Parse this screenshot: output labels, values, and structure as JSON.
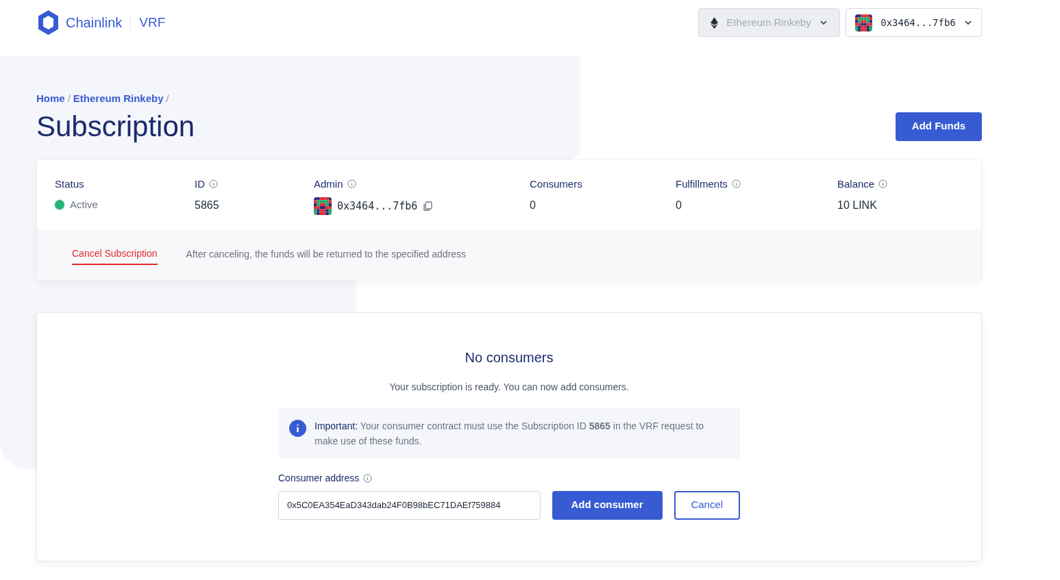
{
  "header": {
    "brand": "Chainlink",
    "product": "VRF",
    "network": {
      "label": "Ethereum Rinkeby",
      "disabled": true
    },
    "account": {
      "label": "0x3464...7fb6"
    }
  },
  "breadcrumb": [
    {
      "label": "Home",
      "separator": "/"
    },
    {
      "label": "Ethereum Rinkeby",
      "separator": "/"
    }
  ],
  "title": "Subscription",
  "add_funds": "Add Funds",
  "stats": [
    {
      "kind": "status",
      "label": "Status",
      "info": false,
      "value": "Active",
      "color": "#22b573"
    },
    {
      "kind": "text",
      "label": "ID",
      "info": true,
      "value": "5865"
    },
    {
      "kind": "address",
      "label": "Admin",
      "info": true,
      "value": "0x3464...7fb6"
    },
    {
      "kind": "text",
      "label": "Consumers",
      "info": false,
      "value": "0"
    },
    {
      "kind": "text",
      "label": "Fulfillments",
      "info": true,
      "value": "0"
    },
    {
      "kind": "text",
      "label": "Balance",
      "info": true,
      "value": "10 LINK"
    }
  ],
  "cancel": {
    "link": "Cancel Subscription",
    "note": "After canceling, the funds will be returned to the specified address"
  },
  "consumers": {
    "heading": "No consumers",
    "subtitle": "Your subscription is ready. You can now add consumers.",
    "notice": {
      "lead": "Important:",
      "text": "Your consumer contract must use the Subscription ID **5865** in the VRF request to make use of these funds."
    },
    "field_label": "Consumer address",
    "field_value": "0x5C0EA354EaD343dab24F0B98bEC71DAEf759884",
    "buttons": [
      {
        "kind": "primary",
        "label": "Add consumer"
      },
      {
        "kind": "outline",
        "label": "Cancel"
      }
    ]
  }
}
